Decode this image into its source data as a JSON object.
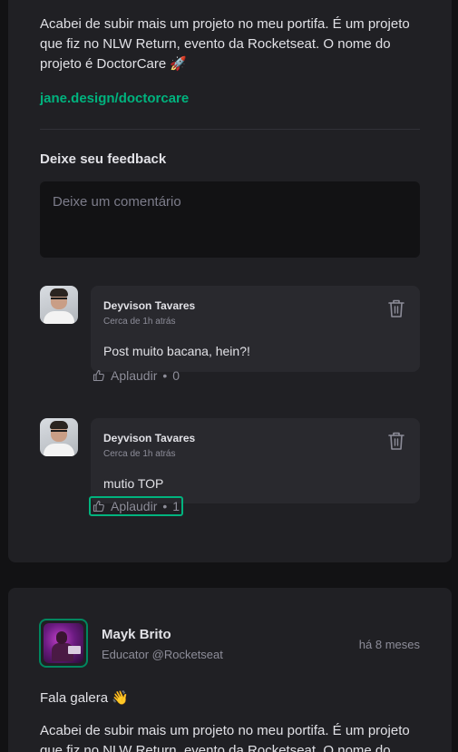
{
  "post1": {
    "text": "Acabei de subir mais um projeto no meu portifa. É um projeto que fiz no NLW Return, evento da Rocketseat. O nome do projeto é DoctorCare 🚀",
    "link": "jane.design/doctorcare",
    "feedback_title": "Deixe seu feedback",
    "comment_placeholder": "Deixe um comentário",
    "comments": [
      {
        "author": "Deyvison Tavares",
        "time": "Cerca de 1h atrás",
        "text": "Post muito bacana, hein?!",
        "applaud_label": "Aplaudir",
        "applaud_count": "0"
      },
      {
        "author": "Deyvison Tavares",
        "time": "Cerca de 1h atrás",
        "text": "mutio TOP",
        "applaud_label": "Aplaudir",
        "applaud_count": "1"
      }
    ]
  },
  "post2": {
    "author": "Mayk Brito",
    "role": "Educator @Rocketseat",
    "time": "há 8 meses",
    "greeting": "Fala galera 👋",
    "text": "Acabei de subir mais um projeto no meu portifa. É um projeto que fiz no NLW Return, evento da Rocketseat. O nome do projeto é"
  },
  "icons": {
    "trash": "trash-icon",
    "applaud": "thumbs-up-icon"
  },
  "colors": {
    "background": "#121214",
    "card": "#202024",
    "comment_card": "#29292e",
    "accent": "#00b37e",
    "border_accent": "#00875f"
  }
}
